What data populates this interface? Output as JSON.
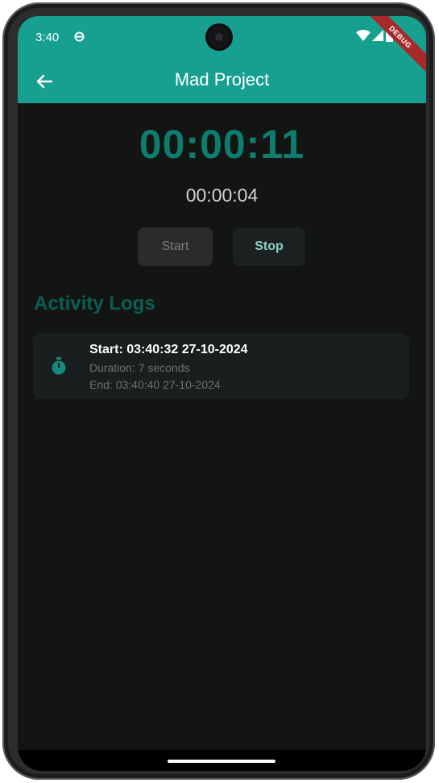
{
  "status": {
    "time": "3:40",
    "debug_label": "DEBUG"
  },
  "appbar": {
    "title": "Mad Project"
  },
  "timers": {
    "elapsed": "00:00:11",
    "lap": "00:00:04"
  },
  "controls": {
    "start_label": "Start",
    "stop_label": "Stop"
  },
  "logs": {
    "title": "Activity Logs",
    "items": [
      {
        "start": "Start: 03:40:32 27-10-2024",
        "duration": "Duration: 7 seconds",
        "end": "End: 03:40:40 27-10-2024"
      }
    ]
  },
  "colors": {
    "app_bar": "#17a08f",
    "accent_timer": "#0f7c70",
    "background": "#121512",
    "debug_banner": "#a8292a"
  },
  "icons": [
    "sync-icon",
    "wifi-icon",
    "signal-icon",
    "battery-icon",
    "back-arrow-icon",
    "stopwatch-icon"
  ]
}
